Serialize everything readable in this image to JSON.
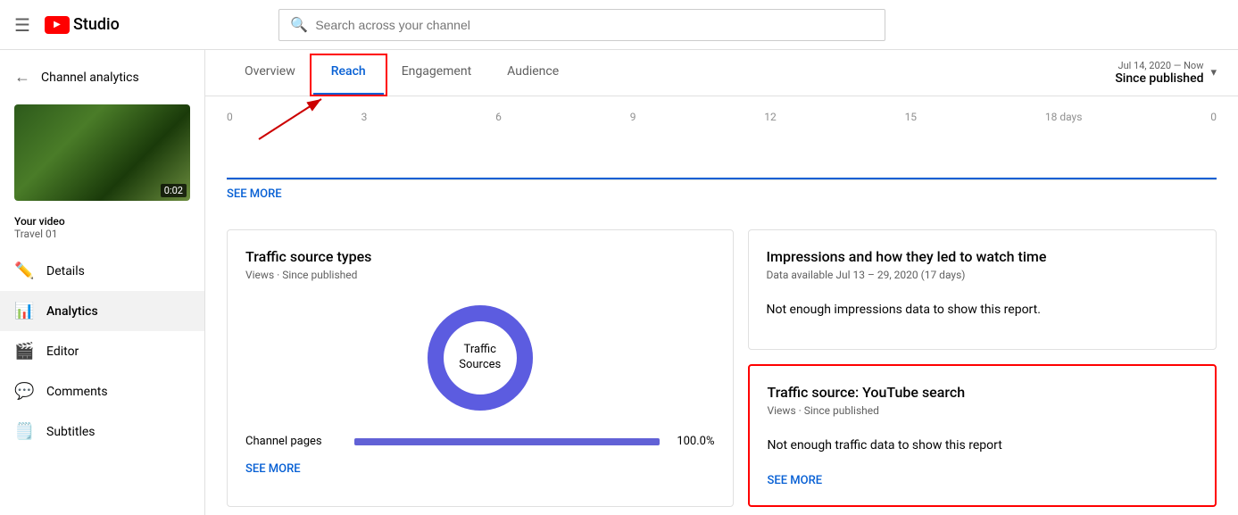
{
  "header": {
    "hamburger": "☰",
    "yt_studio_label": "Studio",
    "search_placeholder": "Search across your channel"
  },
  "sidebar": {
    "back_label": "Channel analytics",
    "thumbnail_duration": "0:02",
    "video_label": "Your video",
    "video_name": "Travel 01",
    "nav": [
      {
        "id": "details",
        "icon": "✏️",
        "label": "Details"
      },
      {
        "id": "analytics",
        "icon": "📊",
        "label": "Analytics",
        "active": true
      },
      {
        "id": "editor",
        "icon": "🎬",
        "label": "Editor"
      },
      {
        "id": "comments",
        "icon": "💬",
        "label": "Comments"
      },
      {
        "id": "subtitles",
        "icon": "🗒️",
        "label": "Subtitles"
      }
    ]
  },
  "tabs": {
    "items": [
      {
        "id": "overview",
        "label": "Overview",
        "active": false
      },
      {
        "id": "reach",
        "label": "Reach",
        "active": true
      },
      {
        "id": "engagement",
        "label": "Engagement",
        "active": false
      },
      {
        "id": "audience",
        "label": "Audience",
        "active": false
      }
    ]
  },
  "date_range": {
    "label": "Jul 14, 2020 — Now",
    "value": "Since published",
    "dropdown_icon": "▾"
  },
  "chart": {
    "axis_labels": [
      "0",
      "3",
      "6",
      "9",
      "12",
      "15",
      "18 days"
    ],
    "right_label": "0",
    "see_more": "SEE MORE"
  },
  "traffic_source_card": {
    "title": "Traffic source types",
    "subtitle": "Views · Since published",
    "donut_label_line1": "Traffic",
    "donut_label_line2": "Sources",
    "bar": {
      "label": "Channel pages",
      "pct": "100.0%",
      "fill_width": "100%"
    },
    "see_more": "SEE MORE"
  },
  "impressions_card": {
    "title": "Impressions and how they led to watch time",
    "subtitle": "Data available Jul 13 – 29, 2020 (17 days)",
    "empty_msg": "Not enough impressions data to show this report."
  },
  "yt_search_card": {
    "title": "Traffic source: YouTube search",
    "subtitle": "Views · Since published",
    "empty_msg": "Not enough traffic data to show this report",
    "see_more": "SEE MORE"
  }
}
